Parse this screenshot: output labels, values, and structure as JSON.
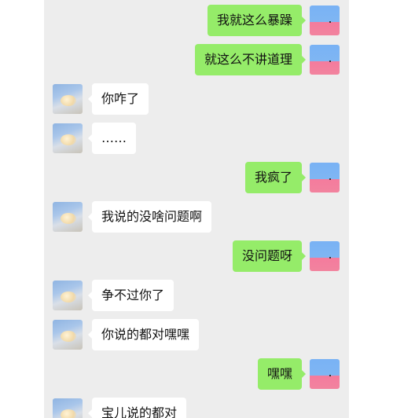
{
  "messages": [
    {
      "side": "right",
      "text": "我就这么暴躁"
    },
    {
      "side": "right",
      "text": "就这么不讲道理"
    },
    {
      "side": "left",
      "text": "你咋了"
    },
    {
      "side": "left",
      "text": "……"
    },
    {
      "side": "right",
      "text": "我疯了"
    },
    {
      "side": "left",
      "text": "我说的没啥问题啊"
    },
    {
      "side": "right",
      "text": "没问题呀"
    },
    {
      "side": "left",
      "text": "争不过你了"
    },
    {
      "side": "left",
      "text": "你说的都对嘿嘿"
    },
    {
      "side": "right",
      "text": "嘿嘿"
    },
    {
      "side": "left",
      "text": "宝儿说的都对"
    }
  ],
  "colors": {
    "chat_background": "#ededed",
    "outgoing_bubble": "#95ec69",
    "incoming_bubble": "#ffffff"
  }
}
